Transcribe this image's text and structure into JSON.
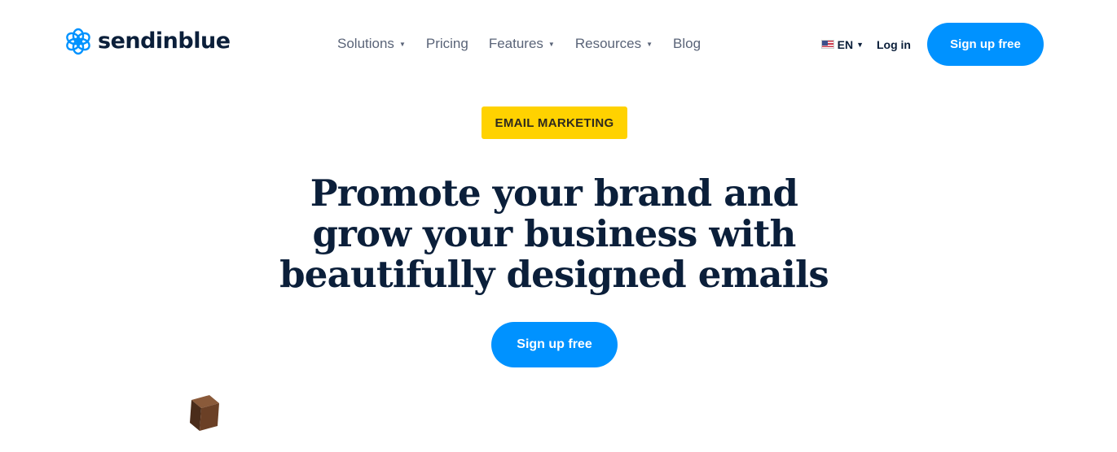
{
  "header": {
    "brand": "sendinblue",
    "nav": [
      {
        "label": "Solutions",
        "has_dropdown": true
      },
      {
        "label": "Pricing",
        "has_dropdown": false
      },
      {
        "label": "Features",
        "has_dropdown": true
      },
      {
        "label": "Resources",
        "has_dropdown": true
      },
      {
        "label": "Blog",
        "has_dropdown": false
      }
    ],
    "language": "EN",
    "login_label": "Log in",
    "signup_label": "Sign up free"
  },
  "hero": {
    "badge": "EMAIL MARKETING",
    "title": "Promote your brand and grow your business with beautifully designed emails",
    "cta_label": "Sign up free"
  },
  "colors": {
    "brand_blue": "#0092ff",
    "navy": "#0b1f3a",
    "badge_yellow": "#ffd200"
  },
  "icons": {
    "logo": "sendinblue-logo-icon",
    "flag": "us-flag-icon",
    "decoration": "wooden-cube-icon"
  }
}
